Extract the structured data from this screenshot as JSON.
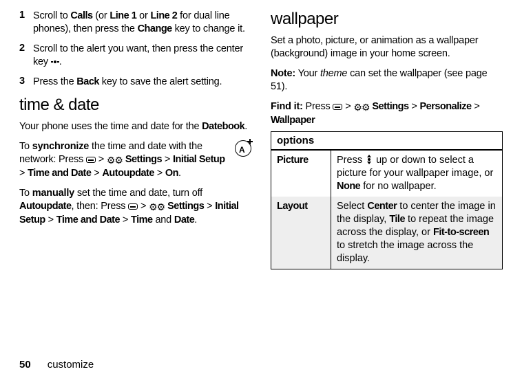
{
  "left": {
    "steps": [
      {
        "num": "1",
        "parts": [
          {
            "t": "Scroll to "
          },
          {
            "t": "Calls",
            "b": true
          },
          {
            "t": " (or "
          },
          {
            "t": "Line 1",
            "b": true
          },
          {
            "t": " or "
          },
          {
            "t": "Line 2",
            "b": true
          },
          {
            "t": " for dual line phones), then press the "
          },
          {
            "t": "Change",
            "b": true
          },
          {
            "t": " key to change it."
          }
        ]
      },
      {
        "num": "2",
        "parts": [
          {
            "t": "Scroll to the alert you want, then press the center key "
          },
          {
            "icon": "center-key"
          },
          {
            "t": "."
          }
        ]
      },
      {
        "num": "3",
        "parts": [
          {
            "t": "Press the "
          },
          {
            "t": "Back",
            "b": true
          },
          {
            "t": " key to save the alert setting."
          }
        ]
      }
    ],
    "sec_time_date": "time & date",
    "td_intro_parts": [
      {
        "t": "Your phone uses the time and date for the "
      },
      {
        "t": "Datebook",
        "b": true
      },
      {
        "t": "."
      }
    ],
    "sync_parts": [
      {
        "t": "To "
      },
      {
        "t": "synchronize",
        "strong": true
      },
      {
        "t": " the time and date with the network: Press "
      },
      {
        "icon": "softkey"
      },
      {
        "t": " > "
      },
      {
        "icon": "settings"
      },
      {
        "t": " "
      },
      {
        "t": "Settings",
        "b": true
      },
      {
        "t": " > "
      },
      {
        "t": "Initial Setup",
        "b": true
      },
      {
        "t": " > "
      },
      {
        "t": "Time and Date",
        "b": true
      },
      {
        "t": " > "
      },
      {
        "t": "Autoupdate",
        "b": true
      },
      {
        "t": " > "
      },
      {
        "t": "On",
        "b": true
      },
      {
        "t": "."
      }
    ],
    "manual_parts": [
      {
        "t": "To "
      },
      {
        "t": "manually",
        "strong": true
      },
      {
        "t": " set the time and date, turn off "
      },
      {
        "t": "Autoupdate",
        "b": true
      },
      {
        "t": ", then: Press "
      },
      {
        "icon": "softkey"
      },
      {
        "t": " > "
      },
      {
        "icon": "settings"
      },
      {
        "t": " "
      },
      {
        "t": "Settings",
        "b": true
      },
      {
        "t": " > "
      },
      {
        "t": "Initial Setup",
        "b": true
      },
      {
        "t": " > "
      },
      {
        "t": "Time and Date",
        "b": true
      },
      {
        "t": " > "
      },
      {
        "t": "Time",
        "b": true
      },
      {
        "t": " and "
      },
      {
        "t": "Date",
        "b": true
      },
      {
        "t": "."
      }
    ]
  },
  "right": {
    "sec_wallpaper": "wallpaper",
    "wp_intro": "Set a photo, picture, or animation as a wallpaper (background) image in your home screen.",
    "wp_note_parts": [
      {
        "t": "Note:",
        "strong": true
      },
      {
        "t": " Your "
      },
      {
        "t": "theme",
        "i": true
      },
      {
        "t": " can set the wallpaper (see page 51)."
      }
    ],
    "findit_parts": [
      {
        "t": "Find it:",
        "strong": true
      },
      {
        "t": " Press "
      },
      {
        "icon": "softkey"
      },
      {
        "t": " > "
      },
      {
        "icon": "settings"
      },
      {
        "t": " "
      },
      {
        "t": "Settings",
        "b": true
      },
      {
        "t": " > "
      },
      {
        "t": "Personalize",
        "b": true
      },
      {
        "t": " > "
      },
      {
        "t": "Wallpaper",
        "b": true
      }
    ],
    "table_header": "options",
    "rows": [
      {
        "label": "Picture",
        "desc_parts": [
          {
            "t": "Press "
          },
          {
            "icon": "nav-updown"
          },
          {
            "t": " up or down to select a picture for your wallpaper image, or "
          },
          {
            "t": "None",
            "b": true
          },
          {
            "t": " for no wallpaper."
          }
        ]
      },
      {
        "label": "Layout",
        "desc_parts": [
          {
            "t": "Select "
          },
          {
            "t": "Center",
            "b": true
          },
          {
            "t": " to center the image in the display, "
          },
          {
            "t": "Tile",
            "b": true
          },
          {
            "t": " to repeat the image across the display, or "
          },
          {
            "t": "Fit-to-screen",
            "b": true
          },
          {
            "t": " to stretch the image across the display."
          }
        ]
      }
    ]
  },
  "footer": {
    "page": "50",
    "section": "customize"
  },
  "aplus_letter": "A"
}
